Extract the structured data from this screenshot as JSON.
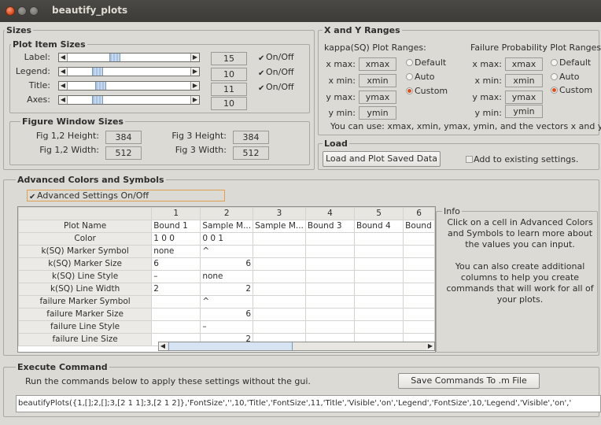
{
  "window": {
    "title": "beautify_plots"
  },
  "sizes": {
    "group_title": "Sizes",
    "plot_items": {
      "group_title": "Plot Item Sizes",
      "rows": [
        {
          "label": "Label:",
          "value": "15",
          "on_off": "On/Off",
          "checked": true,
          "slider_level": 0.6
        },
        {
          "label": "Legend:",
          "value": "10",
          "on_off": "On/Off",
          "checked": true,
          "slider_level": 0.35
        },
        {
          "label": "Title:",
          "value": "11",
          "on_off": "On/Off",
          "checked": true,
          "slider_level": 0.4
        },
        {
          "label": "Axes:",
          "value": "10",
          "checked": false,
          "slider_level": 0.35
        }
      ]
    },
    "figure_window": {
      "group_title": "Figure Window Sizes",
      "fig12_height_label": "Fig 1,2 Height:",
      "fig12_height": "384",
      "fig12_width_label": "Fig 1,2 Width:",
      "fig12_width": "512",
      "fig3_height_label": "Fig 3 Height:",
      "fig3_height": "384",
      "fig3_width_label": "Fig 3 Width:",
      "fig3_width": "512"
    }
  },
  "ranges": {
    "group_title": "X and Y Ranges",
    "kappa": {
      "title": "kappa(SQ) Plot Ranges:",
      "xmax_label": "x max:",
      "xmax": "xmax",
      "xmin_label": "x min:",
      "xmin": "xmin",
      "ymax_label": "y max:",
      "ymax": "ymax",
      "ymin_label": "y min:",
      "ymin": "ymin",
      "radio_default": "Default",
      "radio_auto": "Auto",
      "radio_custom": "Custom",
      "selected": "Custom"
    },
    "failure": {
      "title": "Failure Probability Plot Ranges:",
      "xmax_label": "x max:",
      "xmax": "xmax",
      "xmin_label": "x min:",
      "xmin": "xmin",
      "ymax_label": "y max:",
      "ymax": "ymax",
      "ymin_label": "y min:",
      "ymin": "ymin",
      "radio_default": "Default",
      "radio_auto": "Auto",
      "radio_custom": "Custom",
      "selected": "Custom"
    },
    "hint": "You can use: xmax, xmin, ymax, ymin, and the vectors x and y"
  },
  "load": {
    "group_title": "Load",
    "button": "Load and Plot Saved Data",
    "add_existing": "Add to existing settings."
  },
  "advanced": {
    "group_title": "Advanced Colors and Symbols",
    "toggle_label": "Advanced Settings On/Off",
    "toggle_checked": true,
    "columns": [
      "",
      "1",
      "2",
      "3",
      "4",
      "5",
      "6"
    ],
    "rows": [
      {
        "header": "Plot Name",
        "cells": [
          "Bound 1",
          "Sample M...",
          "Sample M...",
          "Bound 3",
          "Bound 4",
          "Bound"
        ]
      },
      {
        "header": "Color",
        "cells": [
          "1 0 0",
          "0 0 1",
          "",
          "",
          "",
          ""
        ]
      },
      {
        "header": "k(SQ) Marker Symbol",
        "cells": [
          "none",
          "^",
          "",
          "",
          "",
          ""
        ]
      },
      {
        "header": "k(SQ) Marker Size",
        "cells": [
          "6",
          "6",
          "",
          "",
          "",
          ""
        ]
      },
      {
        "header": "k(SQ) Line Style",
        "cells": [
          "–",
          "none",
          "",
          "",
          "",
          ""
        ]
      },
      {
        "header": "k(SQ) Line Width",
        "cells": [
          "2",
          "2",
          "",
          "",
          "",
          ""
        ]
      },
      {
        "header": "failure Marker Symbol",
        "cells": [
          "",
          "^",
          "",
          "",
          "",
          ""
        ]
      },
      {
        "header": "failure Marker Size",
        "cells": [
          "",
          "6",
          "",
          "",
          "",
          ""
        ]
      },
      {
        "header": "failure Line Style",
        "cells": [
          "",
          "–",
          "",
          "",
          "",
          ""
        ]
      },
      {
        "header": "failure Line Size",
        "cells": [
          "",
          "2",
          "",
          "",
          "",
          ""
        ]
      }
    ],
    "info_title": "Info",
    "info_text_1": "Click on a cell in Advanced Colors and Symbols to learn more about the values you can input.",
    "info_text_2": "You can also create additional columns to help you create commands that will work for all of your plots."
  },
  "execute": {
    "group_title": "Execute Command",
    "instructions": "Run the commands below to apply these settings without the gui.",
    "save_button": "Save Commands To .m File",
    "command": "beautifyPlots({1,[];2,[];3,[2 1 1];3,[2 1 2]},'FontSize','',10,'Title','FontSize',11,'Title','Visible','on','Legend','FontSize',10,'Legend','Visible','on','"
  },
  "colors": {
    "titlebar": "#3c3b37",
    "window_bg": "#dcdad5",
    "accent": "#e0501f",
    "scroll_thumb": "#a9c3e3"
  }
}
